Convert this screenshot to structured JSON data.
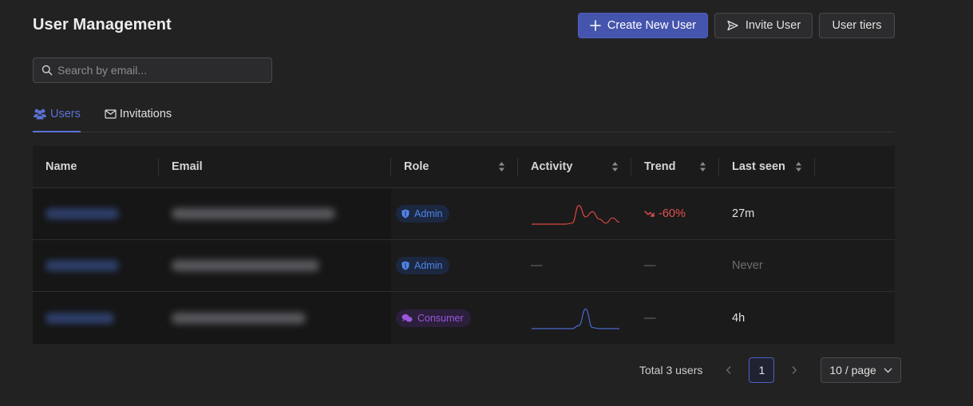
{
  "header": {
    "title": "User Management",
    "create_label": "Create New User",
    "invite_label": "Invite User",
    "tiers_label": "User tiers"
  },
  "search": {
    "placeholder": "Search by email...",
    "value": ""
  },
  "tabs": [
    {
      "label": "Users",
      "icon": "users-icon",
      "active": true
    },
    {
      "label": "Invitations",
      "icon": "mail-icon",
      "active": false
    }
  ],
  "table": {
    "columns": [
      "Name",
      "Email",
      "Role",
      "Activity",
      "Trend",
      "Last seen"
    ],
    "sortable": [
      false,
      false,
      true,
      true,
      true,
      true
    ],
    "rows": [
      {
        "role": "Admin",
        "role_type": "admin",
        "activity": [
          0,
          0,
          0,
          0,
          0,
          0,
          0.05,
          0.9,
          0.35,
          0.6,
          0.25,
          0.05,
          0.3,
          0.1
        ],
        "trend": "-60%",
        "last_seen": "27m"
      },
      {
        "role": "Admin",
        "role_type": "admin",
        "activity": null,
        "activity_empty": "—",
        "trend": "—",
        "last_seen": "Never"
      },
      {
        "role": "Consumer",
        "role_type": "consumer",
        "activity": [
          0,
          0,
          0,
          0,
          0,
          0,
          0,
          0.15,
          0.95,
          0.05,
          0,
          0,
          0,
          0
        ],
        "trend": "—",
        "last_seen": "4h"
      }
    ]
  },
  "colors": {
    "accent": "#4555ad",
    "admin": "#4f86e8",
    "consumer": "#9a57da",
    "trend_down": "#e4524c",
    "spark_red": "#d9463f",
    "spark_blue": "#4a68c9"
  },
  "pagination": {
    "total": "Total 3 users",
    "current_page": "1",
    "page_size": "10 / page"
  }
}
